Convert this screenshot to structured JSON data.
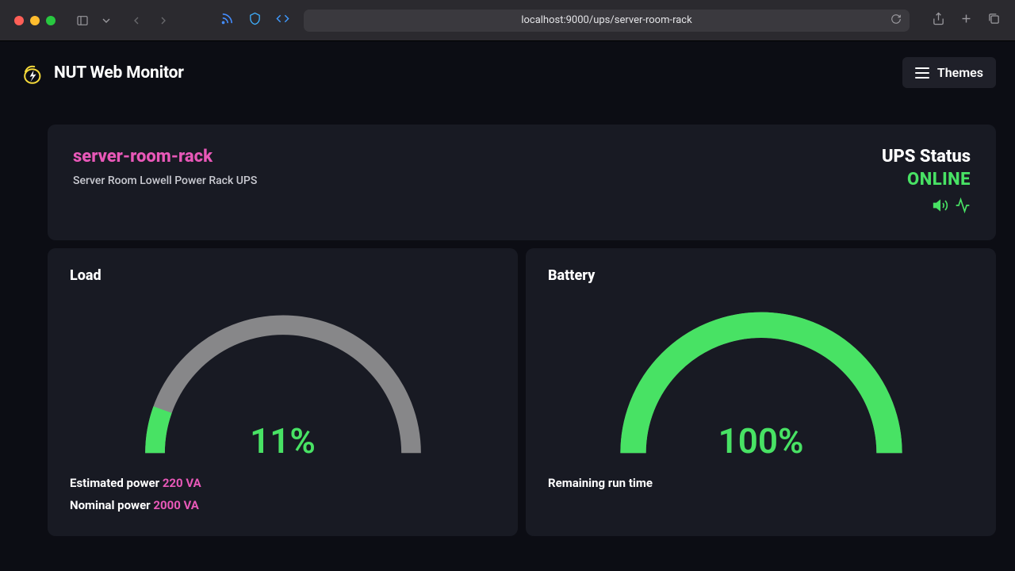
{
  "browser": {
    "url": "localhost:9000/ups/server-room-rack"
  },
  "header": {
    "title": "NUT Web Monitor",
    "themes_label": "Themes"
  },
  "status_card": {
    "server_name": "server-room-rack",
    "server_desc": "Server Room Lowell Power Rack UPS",
    "status_title": "UPS Status",
    "status_value": "ONLINE"
  },
  "gauges": {
    "load": {
      "title": "Load",
      "percent_label": "11%",
      "percent": 11,
      "estimated_label": "Estimated power ",
      "estimated_value": "220 VA",
      "nominal_label": "Nominal power ",
      "nominal_value": "2000 VA"
    },
    "battery": {
      "title": "Battery",
      "percent_label": "100%",
      "percent": 100,
      "runtime_label": "Remaining run time"
    }
  },
  "chart_data": [
    {
      "type": "gauge",
      "title": "Load",
      "value": 11,
      "min": 0,
      "max": 100,
      "unit": "%",
      "meta": {
        "estimated_power_va": 220,
        "nominal_power_va": 2000
      }
    },
    {
      "type": "gauge",
      "title": "Battery",
      "value": 100,
      "min": 0,
      "max": 100,
      "unit": "%"
    }
  ],
  "colors": {
    "accent_pink": "#e858b8",
    "accent_green": "#48e264",
    "card_bg": "#181a23",
    "page_bg": "#0c0d14",
    "gauge_track": "#878789"
  }
}
